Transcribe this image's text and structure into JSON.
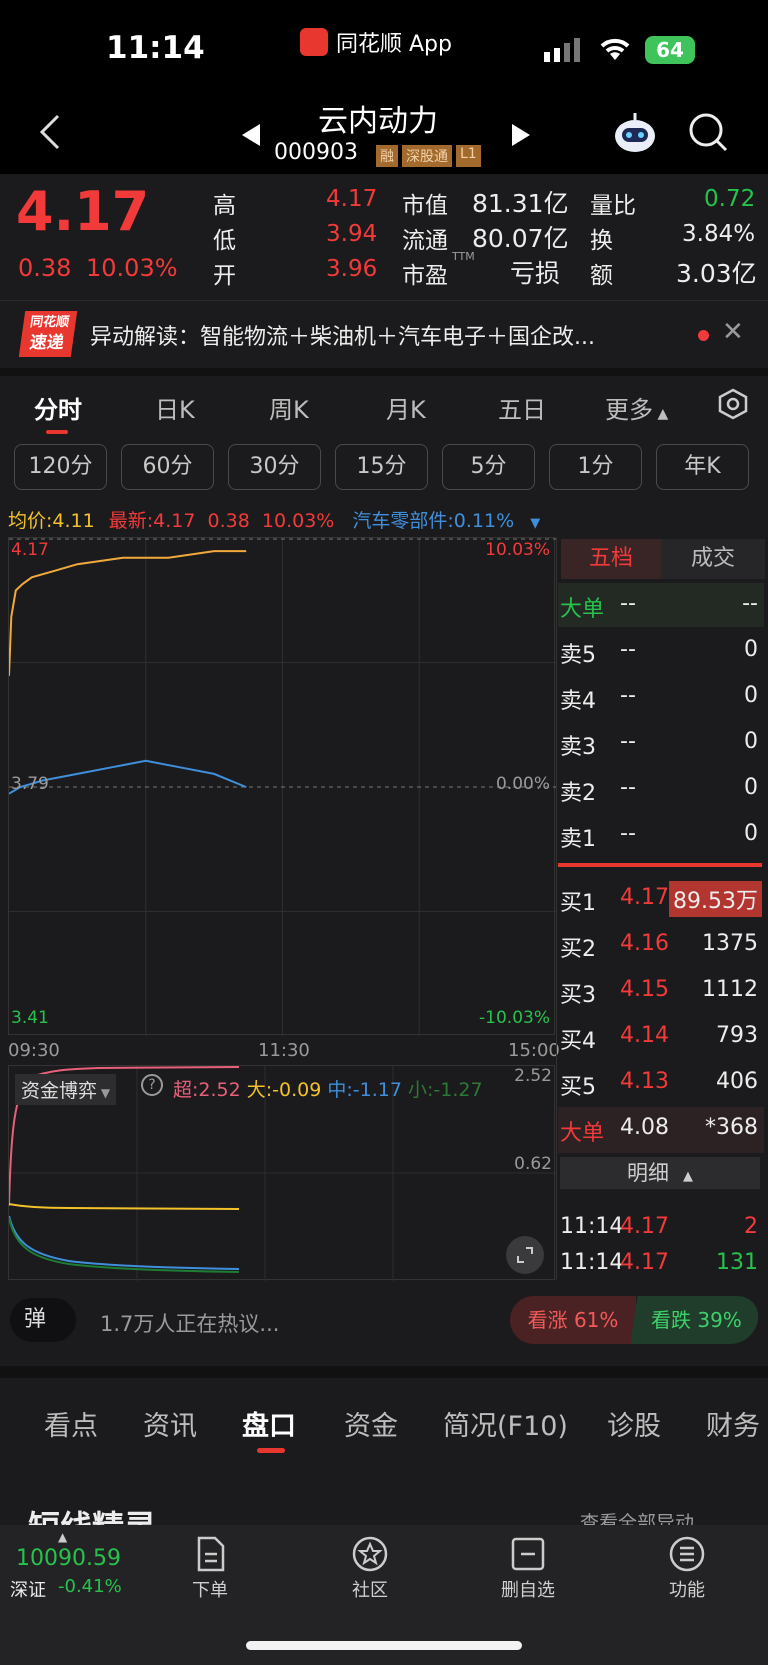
{
  "status": {
    "time": "11:14",
    "app_label": "同花顺 App",
    "battery": "64"
  },
  "header": {
    "stock_name": "云内动力",
    "stock_code": "000903",
    "tags": [
      "融",
      "深股通",
      "L1"
    ]
  },
  "quote": {
    "price": "4.17",
    "change": "0.38",
    "change_pct": "10.03%",
    "stats": [
      {
        "label": "高",
        "value": "4.17"
      },
      {
        "label": "低",
        "value": "3.94"
      },
      {
        "label": "开",
        "value": "3.96"
      },
      {
        "label": "市值",
        "value": "81.31亿"
      },
      {
        "label": "流通",
        "value": "80.07亿"
      },
      {
        "label": "市盈",
        "value": "亏损",
        "sup": "TTM"
      },
      {
        "label": "量比",
        "value": "0.72"
      },
      {
        "label": "换",
        "value": "3.84%"
      },
      {
        "label": "额",
        "value": "3.03亿"
      }
    ]
  },
  "ticker": {
    "logo_top": "同花顺",
    "logo_bottom": "速递",
    "text": "异动解读：智能物流＋柴油机＋汽车电子＋国企改..."
  },
  "chart_tabs": [
    "分时",
    "日K",
    "周K",
    "月K",
    "五日",
    "更多"
  ],
  "period_buttons": [
    "120分",
    "60分",
    "30分",
    "15分",
    "5分",
    "1分",
    "年K"
  ],
  "info_line": {
    "avg_label": "均价:",
    "avg": "4.11",
    "latest_label": "最新:",
    "latest": "4.17",
    "change": "0.38",
    "change_pct": "10.03%",
    "sector": "汽车零部件:",
    "sector_pct": "0.11%"
  },
  "chart_labels": {
    "top_price": "4.17",
    "top_pct": "10.03%",
    "mid_price": "3.79",
    "mid_pct": "0.00%",
    "low_price": "3.41",
    "low_pct": "-10.03%",
    "t_start": "09:30",
    "t_mid": "11:30",
    "t_end": "15:00"
  },
  "chart_data": {
    "type": "line",
    "title": "",
    "x_range": [
      "09:30",
      "15:00"
    ],
    "ylim": [
      3.41,
      4.17
    ],
    "series": [
      {
        "name": "最新",
        "color": "#f2a93b",
        "x": [
          "09:30",
          "09:31",
          "09:33",
          "09:36",
          "09:40",
          "09:50",
          "10:00",
          "10:20",
          "10:40",
          "11:00",
          "11:14"
        ],
        "values": [
          3.96,
          4.05,
          4.09,
          4.1,
          4.11,
          4.12,
          4.13,
          4.14,
          4.14,
          4.15,
          4.15
        ]
      },
      {
        "name": "均价",
        "color": "#3f8fdd",
        "x": [
          "09:30",
          "09:35",
          "09:45",
          "10:00",
          "10:15",
          "10:30",
          "10:45",
          "11:00",
          "11:14"
        ],
        "values": [
          3.78,
          3.79,
          3.8,
          3.81,
          3.82,
          3.83,
          3.82,
          3.81,
          3.79
        ]
      }
    ]
  },
  "order_book": {
    "tab_five": "五档",
    "tab_trade": "成交",
    "big_top": {
      "label": "大单",
      "price": "--",
      "vol": "--"
    },
    "sells": [
      {
        "label": "卖5",
        "price": "--",
        "vol": "0"
      },
      {
        "label": "卖4",
        "price": "--",
        "vol": "0"
      },
      {
        "label": "卖3",
        "price": "--",
        "vol": "0"
      },
      {
        "label": "卖2",
        "price": "--",
        "vol": "0"
      },
      {
        "label": "卖1",
        "price": "--",
        "vol": "0"
      }
    ],
    "buys": [
      {
        "label": "买1",
        "price": "4.17",
        "vol": "89.53万"
      },
      {
        "label": "买2",
        "price": "4.16",
        "vol": "1375"
      },
      {
        "label": "买3",
        "price": "4.15",
        "vol": "1112"
      },
      {
        "label": "买4",
        "price": "4.14",
        "vol": "793"
      },
      {
        "label": "买5",
        "price": "4.13",
        "vol": "406"
      }
    ],
    "big_bottom": {
      "label": "大单",
      "price": "4.08",
      "vol": "*368"
    },
    "detail_label": "明细",
    "trades": [
      {
        "time": "11:14",
        "price": "4.17",
        "vol": "2"
      },
      {
        "time": "11:14",
        "price": "4.17",
        "vol": "131"
      }
    ]
  },
  "capital": {
    "selector": "资金博弈",
    "super": "超:2.52",
    "big": "大:-0.09",
    "mid": "中:-1.17",
    "small": "小:-1.27",
    "scale_top": "2.52",
    "scale_mid": "0.62"
  },
  "discussion": {
    "badge": "弹",
    "text": "1.7万人正在热议...",
    "up": "看涨 61%",
    "down": "看跌 39%"
  },
  "bottom_tabs": [
    "看点",
    "资讯",
    "盘口",
    "资金",
    "简况(F10)",
    "诊股",
    "财务"
  ],
  "section": {
    "title": "短线精灵",
    "link": "查看全部异动"
  },
  "index": {
    "value": "10090.59",
    "name": "深证",
    "pct": "-0.41%"
  },
  "nav": [
    "下单",
    "社区",
    "删自选",
    "功能"
  ],
  "colors": {
    "up": "#f23a3a",
    "down": "#27c24c",
    "accent": "#e8372f",
    "price_line": "#f2a93b",
    "avg_line": "#3f8fdd"
  }
}
